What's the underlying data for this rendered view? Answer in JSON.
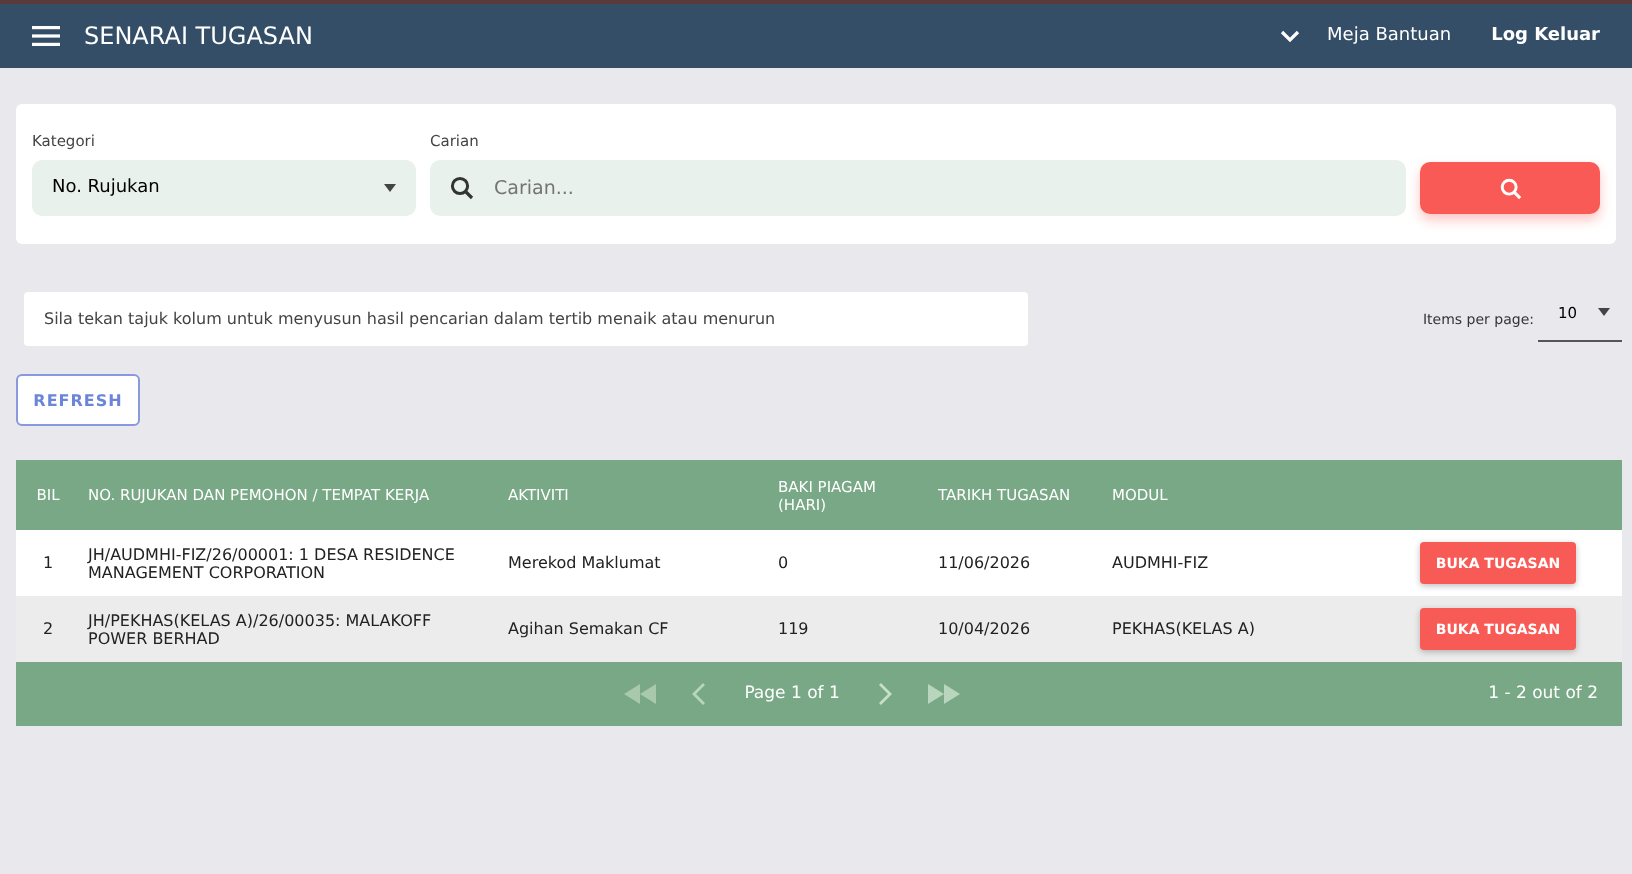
{
  "header": {
    "title": "SENARAI TUGASAN",
    "links": [
      "Meja Bantuan",
      "Log Keluar"
    ]
  },
  "search": {
    "category_label": "Kategori",
    "category_value": "No. Rujukan",
    "search_label": "Carian",
    "placeholder": "Carian..."
  },
  "notice": "Sila tekan tajuk kolum untuk menyusun hasil pencarian dalam tertib menaik atau menurun",
  "items_per_page": {
    "label": "Items per page:",
    "value": "10"
  },
  "refresh": "REFRESH",
  "table": {
    "columns": [
      "BIL",
      "NO. RUJUKAN DAN PEMOHON / TEMPAT KERJA",
      "AKTIVITI",
      "BAKI PIAGAM (HARI)",
      "TARIKH TUGASAN",
      "MODUL"
    ],
    "rows": [
      {
        "bil": "1",
        "ref": "JH/AUDMHI-FIZ/26/00001: 1 DESA RESIDENCE MANAGEMENT CORPORATION",
        "activity": "Merekod Maklumat",
        "baki": "0",
        "date": "11/06/2026",
        "module": "AUDMHI-FIZ",
        "action": "BUKA TUGASAN"
      },
      {
        "bil": "2",
        "ref": "JH/PEKHAS(KELAS A)/26/00035: MALAKOFF POWER BERHAD",
        "activity": "Agihan Semakan CF",
        "baki": "119",
        "date": "10/04/2026",
        "module": "PEKHAS(KELAS A)",
        "action": "BUKA TUGASAN"
      }
    ]
  },
  "pagination": {
    "page": "Page 1 of 1",
    "range": "1 - 2 out of 2"
  }
}
